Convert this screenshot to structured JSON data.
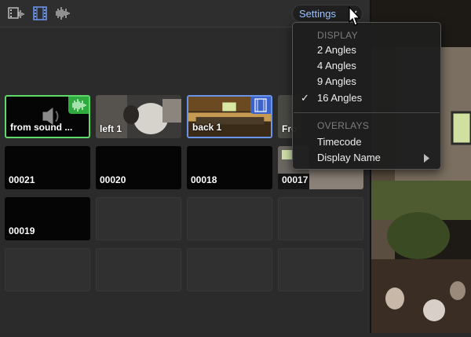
{
  "toolbar": {
    "settings_label": "Settings"
  },
  "angles": [
    {
      "label": "from sound ...",
      "state": "audio-selected"
    },
    {
      "label": "left 1",
      "state": "normal"
    },
    {
      "label": "back 1",
      "state": "video-selected"
    },
    {
      "label": "Fro",
      "state": "normal"
    },
    {
      "label": "00021",
      "state": "normal"
    },
    {
      "label": "00020",
      "state": "normal"
    },
    {
      "label": "00018",
      "state": "normal"
    },
    {
      "label": "00017",
      "state": "normal"
    },
    {
      "label": "00019",
      "state": "normal"
    }
  ],
  "settings_menu": {
    "display_header": "DISPLAY",
    "display_options": [
      "2 Angles",
      "4 Angles",
      "9 Angles",
      "16 Angles"
    ],
    "checked_option": "16 Angles",
    "check_mark": "✓",
    "overlays_header": "OVERLAYS",
    "overlay_options": [
      "Timecode",
      "Display Name"
    ]
  },
  "colors": {
    "audio_highlight": "#5fd96a",
    "video_highlight": "#6a94e8",
    "settings_text": "#9ec3ff"
  }
}
